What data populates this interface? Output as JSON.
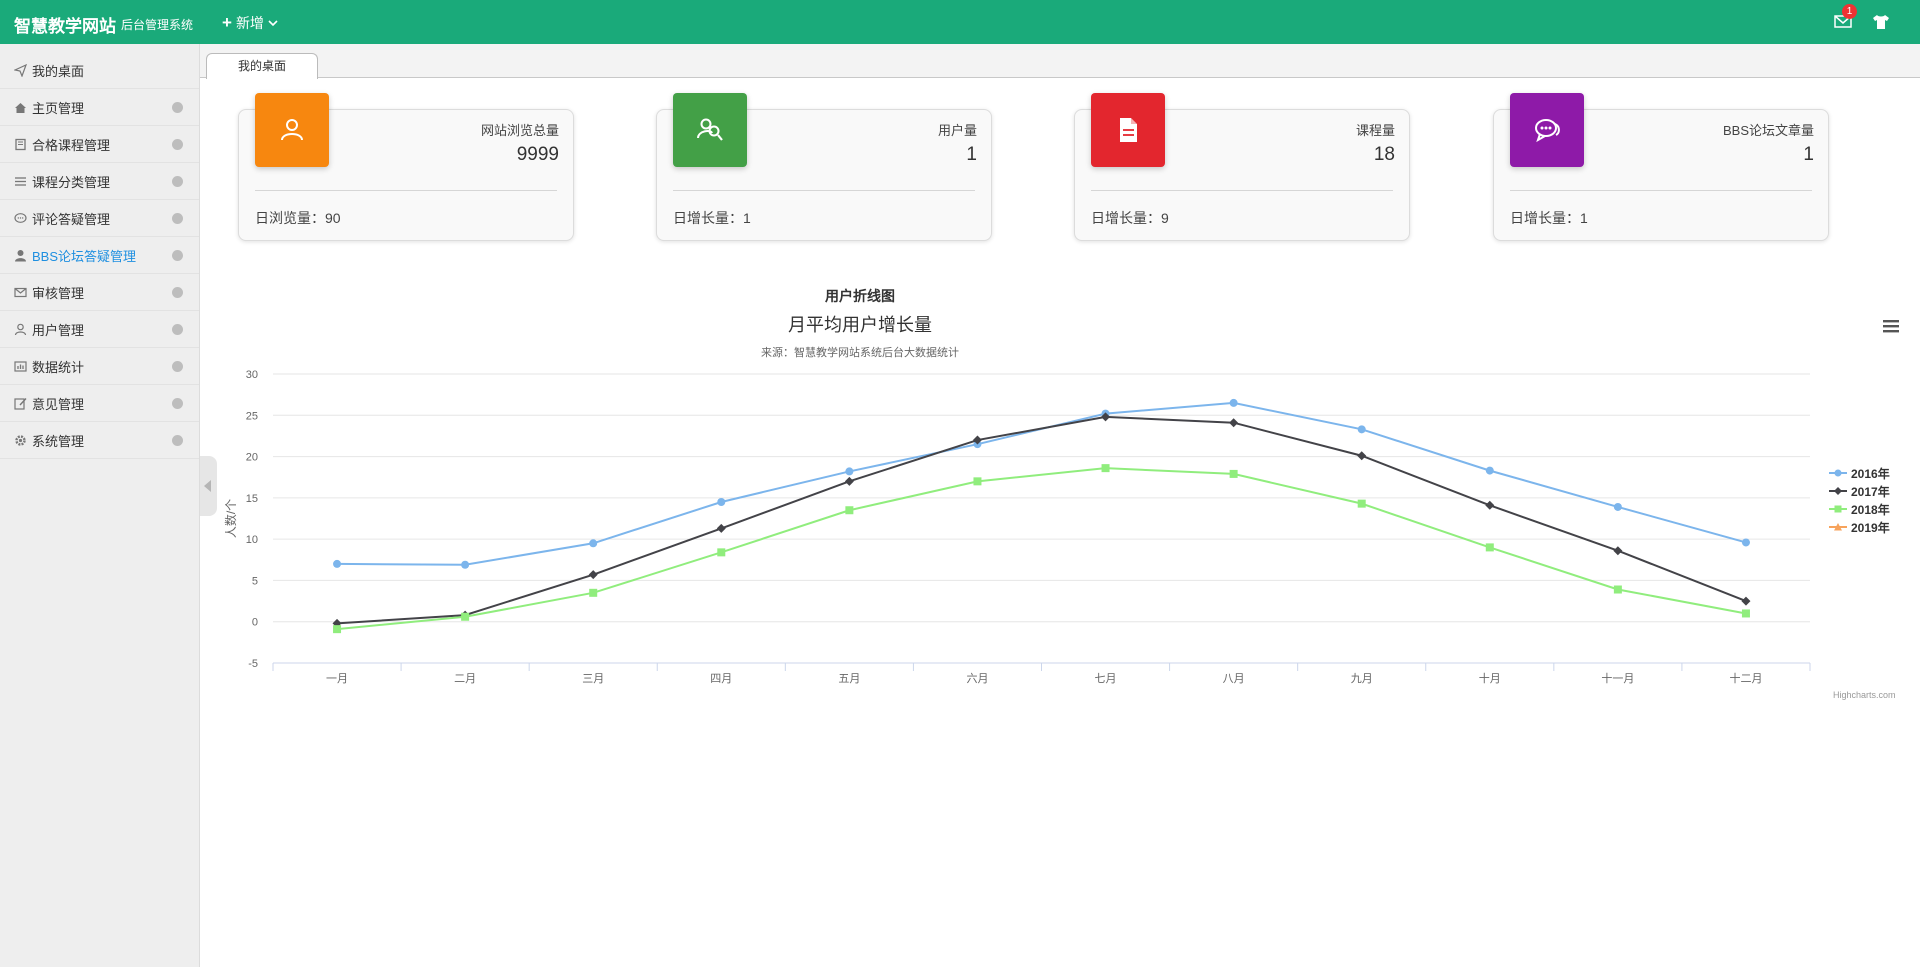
{
  "header": {
    "brand": "智慧教学网站",
    "subtitle": "后台管理系统",
    "add_label": "新增",
    "mail_count": "1",
    "accent": "#1aaa7a"
  },
  "sidebar": {
    "items": [
      {
        "label": "我的桌面",
        "icon": "paper-plane-icon",
        "dot": false,
        "active": false
      },
      {
        "label": "主页管理",
        "icon": "home-icon",
        "dot": true,
        "active": false
      },
      {
        "label": "合格课程管理",
        "icon": "book-icon",
        "dot": true,
        "active": false
      },
      {
        "label": "课程分类管理",
        "icon": "list-icon",
        "dot": true,
        "active": false
      },
      {
        "label": "评论答疑管理",
        "icon": "comment-icon",
        "dot": true,
        "active": false
      },
      {
        "label": "BBS论坛答疑管理",
        "icon": "user-icon",
        "dot": true,
        "active": true
      },
      {
        "label": "审核管理",
        "icon": "envelope-icon",
        "dot": true,
        "active": false
      },
      {
        "label": "用户管理",
        "icon": "person-icon",
        "dot": true,
        "active": false
      },
      {
        "label": "数据统计",
        "icon": "stats-icon",
        "dot": true,
        "active": false
      },
      {
        "label": "意见管理",
        "icon": "edit-icon",
        "dot": true,
        "active": false
      },
      {
        "label": "系统管理",
        "icon": "gear-icon",
        "dot": true,
        "active": false
      }
    ]
  },
  "tabs": [
    {
      "label": "我的桌面"
    }
  ],
  "cards": [
    {
      "label": "网站浏览总量",
      "value": "9999",
      "foot": "日浏览量：90",
      "color": "#f7870f",
      "icon": "user-icon"
    },
    {
      "label": "用户量",
      "value": "1",
      "foot": "日增长量：1",
      "color": "#43a047",
      "icon": "users-icon"
    },
    {
      "label": "课程量",
      "value": "18",
      "foot": "日增长量：9",
      "color": "#e3262e",
      "icon": "document-icon"
    },
    {
      "label": "BBS论坛文章量",
      "value": "1",
      "foot": "日增长量：1",
      "color": "#8e1aa8",
      "icon": "chat-icon"
    }
  ],
  "chart_data": {
    "type": "line",
    "heading": "用户折线图",
    "title": "月平均用户增长量",
    "subtitle": "来源：智慧教学网站系统后台大数据统计",
    "ylabel": "人数/个",
    "xlabel": "",
    "credits": "Highcharts.com",
    "categories": [
      "一月",
      "二月",
      "三月",
      "四月",
      "五月",
      "六月",
      "七月",
      "八月",
      "九月",
      "十月",
      "十一月",
      "十二月"
    ],
    "ylim": [
      -5,
      30
    ],
    "yticks": [
      -5,
      0,
      5,
      10,
      15,
      20,
      25,
      30
    ],
    "grid": true,
    "legend_position": "right",
    "series": [
      {
        "name": "2016年",
        "color": "#7cb5ec",
        "marker": "circle",
        "values": [
          7.0,
          6.9,
          9.5,
          14.5,
          18.2,
          21.5,
          25.2,
          26.5,
          23.3,
          18.3,
          13.9,
          9.6
        ]
      },
      {
        "name": "2017年",
        "color": "#434348",
        "marker": "diamond",
        "values": [
          -0.2,
          0.8,
          5.7,
          11.3,
          17.0,
          22.0,
          24.8,
          24.1,
          20.1,
          14.1,
          8.6,
          2.5
        ]
      },
      {
        "name": "2018年",
        "color": "#90ed7d",
        "marker": "square",
        "values": [
          -0.9,
          0.6,
          3.5,
          8.4,
          13.5,
          17.0,
          18.6,
          17.9,
          14.3,
          9.0,
          3.9,
          1.0
        ]
      },
      {
        "name": "2019年",
        "color": "#f7a35c",
        "marker": "triangle",
        "values": []
      }
    ]
  }
}
